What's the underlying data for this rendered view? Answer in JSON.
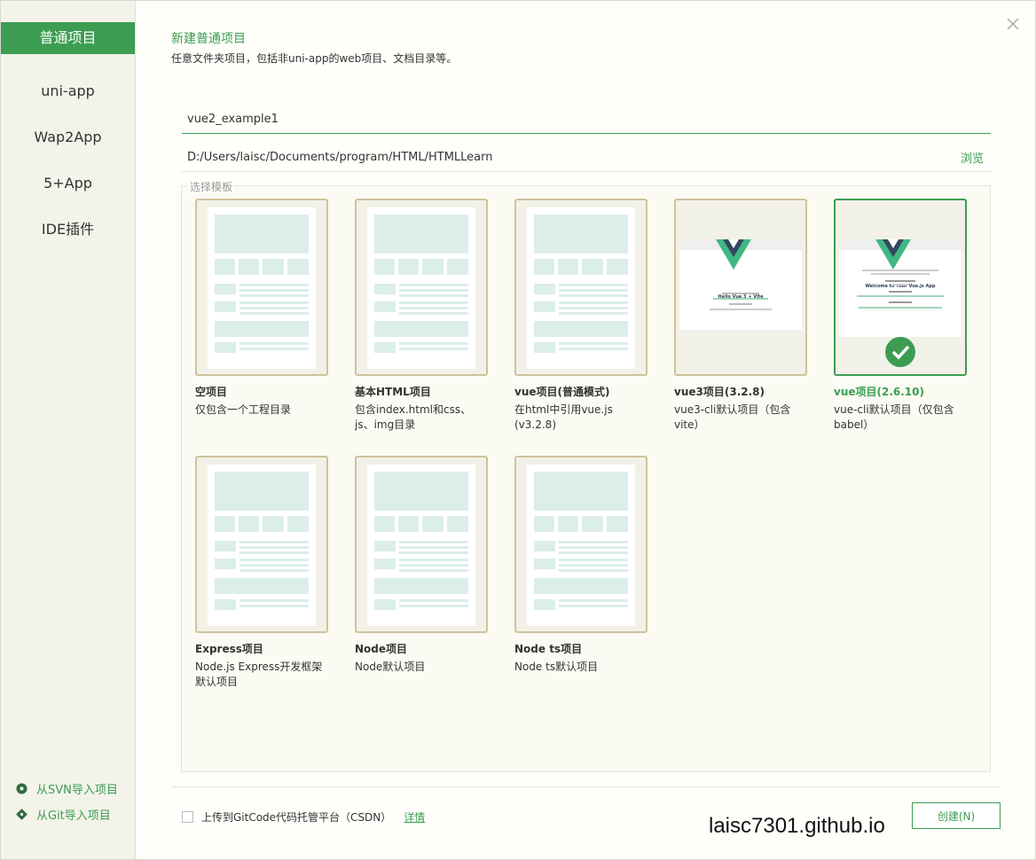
{
  "sidebar": {
    "items": [
      {
        "label": "普通项目",
        "active": true
      },
      {
        "label": "uni-app"
      },
      {
        "label": "Wap2App"
      },
      {
        "label": "5+App"
      },
      {
        "label": "IDE插件"
      }
    ],
    "svn_import": "从SVN导入项目",
    "git_import": "从Git导入项目"
  },
  "header": {
    "title": "新建普通项目",
    "subtitle": "任意文件夹项目，包括非uni-app的web项目、文档目录等。"
  },
  "form": {
    "project_name": "vue2_example1",
    "path": "D:/Users/laisc/Documents/program/HTML/HTMLLearn",
    "browse_label": "浏览"
  },
  "templates": {
    "legend": "选择模板",
    "items": [
      {
        "title": "空项目",
        "desc": "仅包含一个工程目录",
        "kind": "wireframe"
      },
      {
        "title": "基本HTML项目",
        "desc": "包含index.html和css、js、img目录",
        "kind": "wireframe"
      },
      {
        "title": "vue项目(普通模式)",
        "desc": "在html中引用vue.js (v3.2.8)",
        "kind": "wireframe"
      },
      {
        "title": "vue3项目(3.2.8)",
        "desc": "vue3-cli默认项目（包含vite）",
        "kind": "vue3",
        "preview_heading": "Hello Vue 3 + Vite"
      },
      {
        "title": "vue项目(2.6.10)",
        "desc": "vue-cli默认项目（仅包含babel）",
        "kind": "vue2",
        "selected": true,
        "preview_heading": "Welcome to Your Vue.js App"
      },
      {
        "title": "Express项目",
        "desc": "Node.js Express开发框架默认项目",
        "kind": "wireframe"
      },
      {
        "title": "Node项目",
        "desc": "Node默认项目",
        "kind": "wireframe"
      },
      {
        "title": "Node ts项目",
        "desc": "Node ts默认项目",
        "kind": "wireframe"
      }
    ]
  },
  "footer": {
    "upload_label": "上传到GitCode代码托管平台（CSDN）",
    "details_label": "详情",
    "create_label": "创建(N)",
    "watermark": "laisc7301.github.io"
  },
  "colors": {
    "accent": "#3c9d52",
    "card_border": "#cfc39a",
    "wireframe_fill": "#dceee9"
  },
  "icons": {
    "close": "close-icon",
    "svn": "svn-icon",
    "git": "git-icon",
    "selected": "check-circle-icon"
  }
}
